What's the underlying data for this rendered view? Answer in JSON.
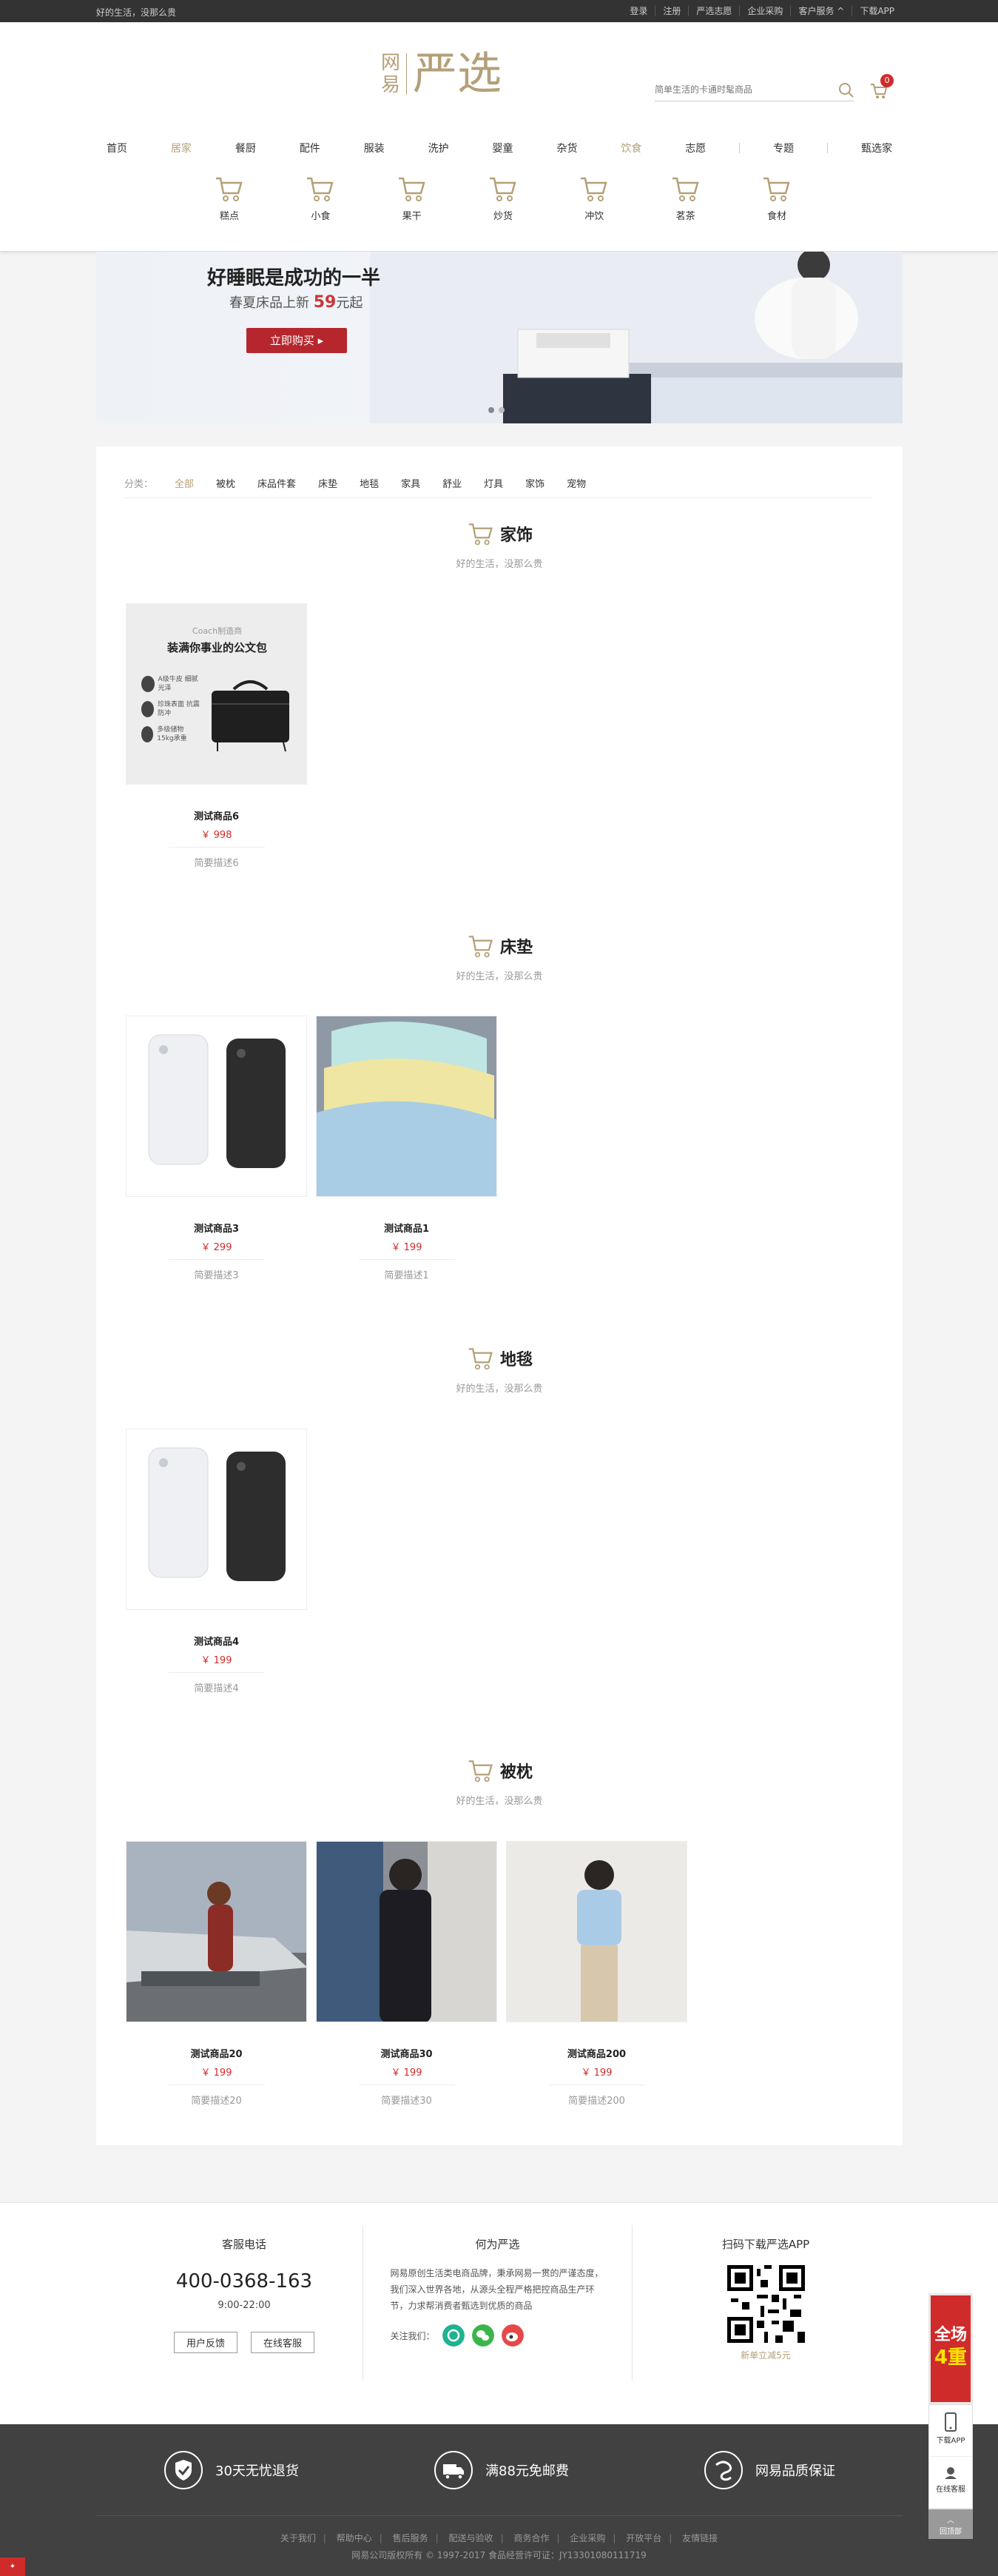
{
  "topbar": {
    "slogan": "好的生活，没那么贵",
    "links": [
      "登录",
      "注册",
      "严选志愿",
      "企业采购",
      "客户服务 ^",
      "下载APP"
    ]
  },
  "header": {
    "logo_small_1": "网",
    "logo_small_2": "易",
    "logo_big": "严选",
    "search_placeholder": "简单生活的卡通时髦商品",
    "cart_count": "0"
  },
  "nav": [
    "首页",
    "居家",
    "餐厨",
    "配件",
    "服装",
    "洗护",
    "婴童",
    "杂货",
    "饮食",
    "志愿",
    "专题",
    "甄选家"
  ],
  "nav_active": "饮食",
  "subnav": [
    "糕点",
    "小食",
    "果干",
    "炒货",
    "冲饮",
    "茗茶",
    "食材"
  ],
  "banner": {
    "title": "好睡眠是成功的一半",
    "sub_prefix": "春夏床品上新 ",
    "sub_price": "59",
    "sub_suffix": "元起",
    "button": "立即购买 ▸"
  },
  "category_tabs": {
    "label": "分类：",
    "tabs": [
      "全部",
      "被枕",
      "床品件套",
      "床垫",
      "地毯",
      "家具",
      "舒业",
      "灯具",
      "家饰",
      "宠物"
    ],
    "active": "全部"
  },
  "sections": [
    {
      "title": "家饰",
      "subtitle": "好的生活，没那么贵",
      "goods": [
        {
          "name": "测试商品6",
          "price": "￥ 998",
          "desc": "简要描述6",
          "poster": {
            "brand": "Coach制造商",
            "headline": "装满你事业的公文包",
            "features": [
              "A级牛皮 细腻光泽",
              "珍珠表面 抗震防冲",
              "多级储物 15kg承重"
            ]
          }
        }
      ]
    },
    {
      "title": "床垫",
      "subtitle": "好的生活，没那么贵",
      "goods": [
        {
          "name": "测试商品3",
          "price": "￥ 299",
          "desc": "简要描述3"
        },
        {
          "name": "测试商品1",
          "price": "￥ 199",
          "desc": "简要描述1"
        }
      ]
    },
    {
      "title": "地毯",
      "subtitle": "好的生活，没那么贵",
      "goods": [
        {
          "name": "测试商品4",
          "price": "￥ 199",
          "desc": "简要描述4"
        }
      ]
    },
    {
      "title": "被枕",
      "subtitle": "好的生活，没那么贵",
      "goods": [
        {
          "name": "测试商品20",
          "price": "￥ 199",
          "desc": "简要描述20"
        },
        {
          "name": "测试商品30",
          "price": "￥ 199",
          "desc": "简要描述30"
        },
        {
          "name": "测试商品200",
          "price": "￥ 199",
          "desc": "简要描述200"
        }
      ]
    }
  ],
  "footer": {
    "service_title": "客服电话",
    "phone": "400-0368-163",
    "hours": "9:00-22:00",
    "btn_feedback": "用户反馈",
    "btn_online": "在线客服",
    "about_title": "何为严选",
    "about_text": "网易原创生活类电商品牌，秉承网易一贯的严谨态度，我们深入世界各地，从源头全程严格把控商品生产环节，力求帮消费者甄选到优质的商品",
    "follow": "关注我们：",
    "app_title": "扫码下载严选APP",
    "app_caption": "新单立减5元",
    "promises": [
      "30天无忧退货",
      "满88元免邮费",
      "网易品质保证"
    ],
    "links": [
      "关于我们",
      "帮助中心",
      "售后服务",
      "配送与验收",
      "商务合作",
      "企业采购",
      "开放平台"
    ],
    "links_last": "友情链接",
    "copyright": "网易公司版权所有 © 1997-2017   食品经营许可证：JY13301080111719"
  },
  "side": {
    "promo_1": "全场",
    "promo_2": "4重",
    "download": "下载APP",
    "service": "在线客服",
    "top": "回顶部"
  },
  "colors": {
    "brand": "#b4a078",
    "price": "#d02b2b",
    "dark_footer": "#414141"
  }
}
